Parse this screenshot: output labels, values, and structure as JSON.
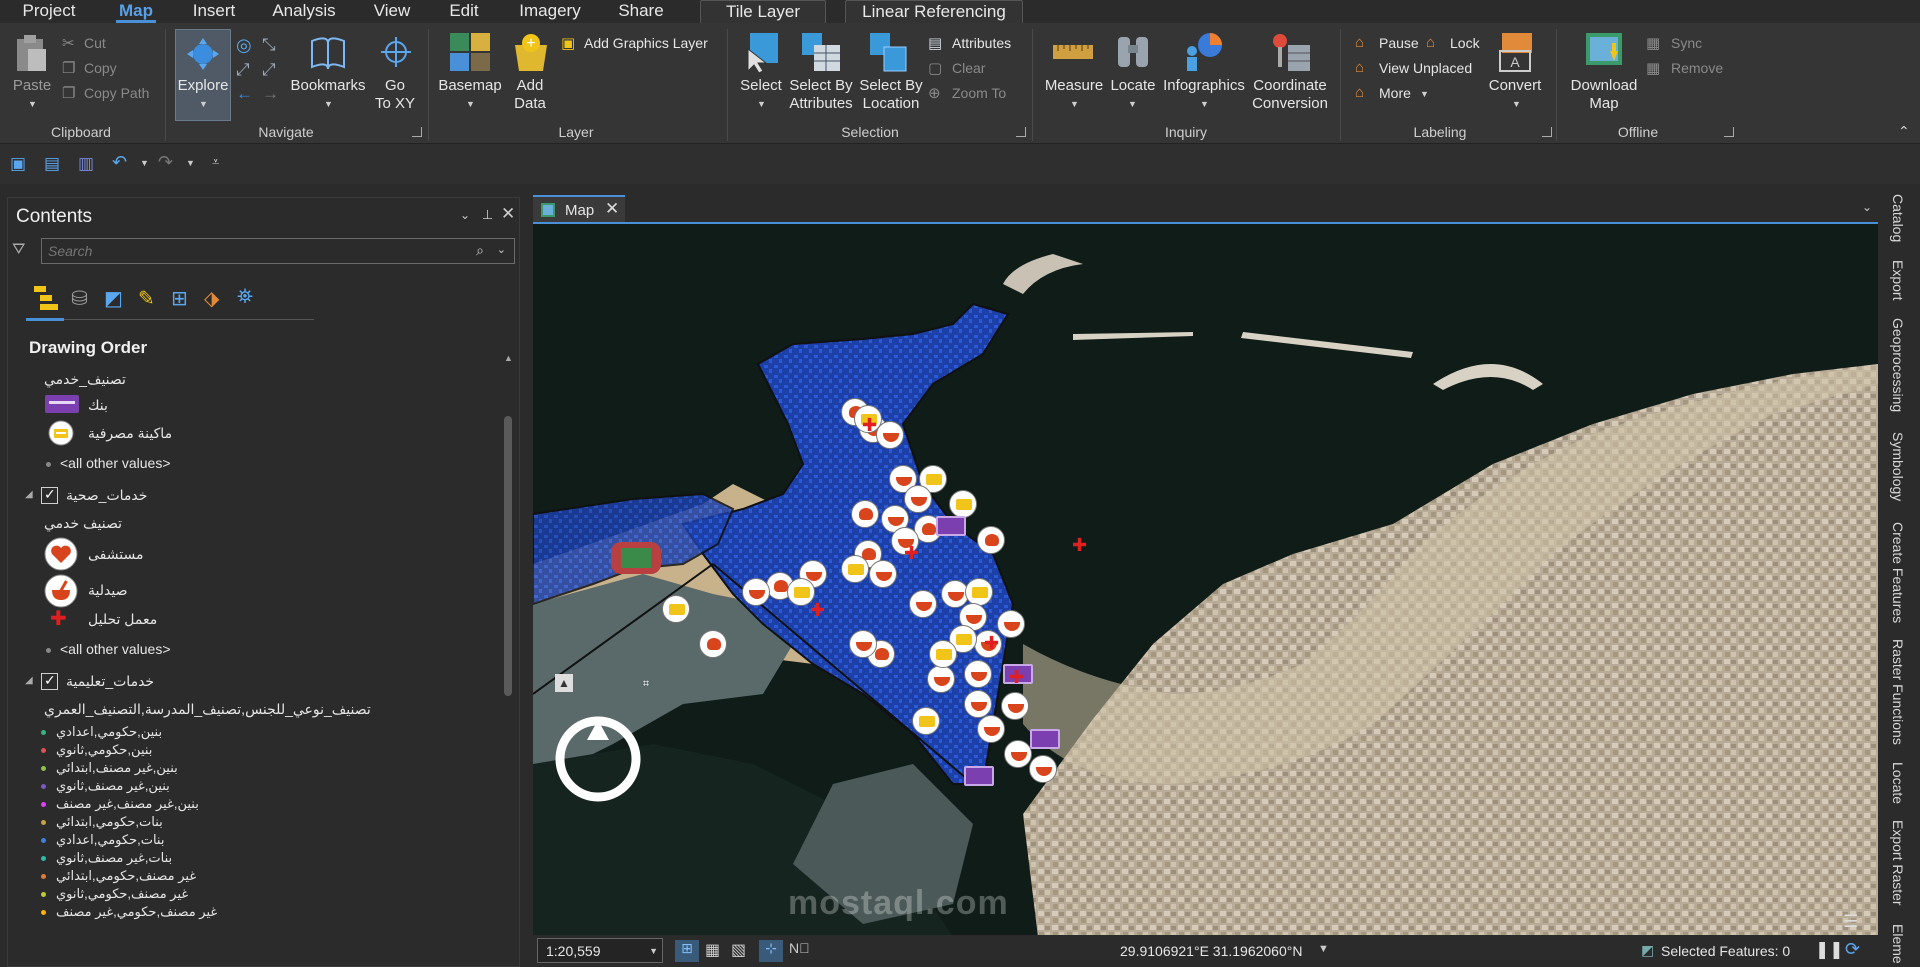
{
  "ribbon_tabs": [
    "Project",
    "Map",
    "Insert",
    "Analysis",
    "View",
    "Edit",
    "Imagery",
    "Share"
  ],
  "contextual_tabs": [
    "Tile Layer",
    "Linear Referencing"
  ],
  "clipboard": {
    "paste": "Paste",
    "cut": "Cut",
    "copy": "Copy",
    "copy_path": "Copy Path",
    "group": "Clipboard"
  },
  "navigate": {
    "explore": "Explore",
    "bookmarks": "Bookmarks",
    "go_to_xy": "Go\nTo XY",
    "group": "Navigate"
  },
  "layer": {
    "basemap": "Basemap",
    "add_data": "Add\nData",
    "add_graphics_layer": "Add Graphics Layer",
    "group": "Layer"
  },
  "selection": {
    "select": "Select",
    "select_by_attributes": "Select By\nAttributes",
    "select_by_location": "Select By\nLocation",
    "attributes": "Attributes",
    "clear": "Clear",
    "zoom_to": "Zoom To",
    "group": "Selection"
  },
  "inquiry": {
    "measure": "Measure",
    "locate": "Locate",
    "infographics": "Infographics",
    "coordinate_conversion": "Coordinate\nConversion",
    "group": "Inquiry"
  },
  "labeling": {
    "pause": "Pause",
    "lock": "Lock",
    "view_unplaced": "View Unplaced",
    "more": "More",
    "convert": "Convert",
    "group": "Labeling"
  },
  "offline": {
    "download_map": "Download\nMap",
    "sync": "Sync",
    "remove": "Remove",
    "group": "Offline"
  },
  "contents": {
    "title": "Contents",
    "search_placeholder": "Search",
    "drawing_order": "Drawing Order",
    "items": [
      "تصنيف_خدمي",
      "بنك",
      "ماكينة مصرفية",
      "<all other values>",
      "خدمات_صحية",
      "تصنيف خدمي",
      "مستشفى",
      "صيدلية",
      "معمل تحليل",
      "<all other values>",
      "خدمات_تعليمية",
      "تصنيف_نوعي_للجنس,تصنيف_المدرسة,التصنيف_العمري"
    ],
    "school_classes": [
      "بنين,حكومي,اعدادي",
      "بنين,حكومي,ثانوي",
      "بنين,غير مصنف,ابتدائي",
      "بنين,غير مصنف,ثانوي",
      "بنين,غير مصنف,غير مصنف",
      "بنات,حكومي,ابتدائي",
      "بنات,حكومي,اعدادي",
      "بنات,غير مصنف,ثانوي",
      "غير مصنف,حكومي,ابتدائي",
      "غير مصنف,حكومي,ثانوي",
      "غير مصنف,حكومي,غير مصنف"
    ],
    "school_dot_colors": [
      "#36b37e",
      "#e05050",
      "#8bc34a",
      "#7e57c2",
      "#e040fb",
      "#c8a040",
      "#3f7fe0",
      "#2eb8a8",
      "#e07a3a",
      "#c0ca33",
      "#ffb300"
    ]
  },
  "map": {
    "tab_label": "Map",
    "scale": "1:20,559",
    "coordinates": "29.9106921°E 31.1962060°N",
    "selected_features": "Selected Features: 0",
    "watermark": "mostaql.com"
  },
  "right_panes": [
    "Catalog",
    "Export",
    "Geoprocessing",
    "Symbology",
    "Create Features",
    "Raster Functions",
    "Locate",
    "Export Raster",
    "Eleme"
  ],
  "colors": {
    "accent": "#4a90d9",
    "parcel_blue": "#1e4fc0",
    "pharmacy_red": "#d8441c",
    "bank_purple": "#7b3fb0",
    "atm_yellow": "#f0c419"
  }
}
